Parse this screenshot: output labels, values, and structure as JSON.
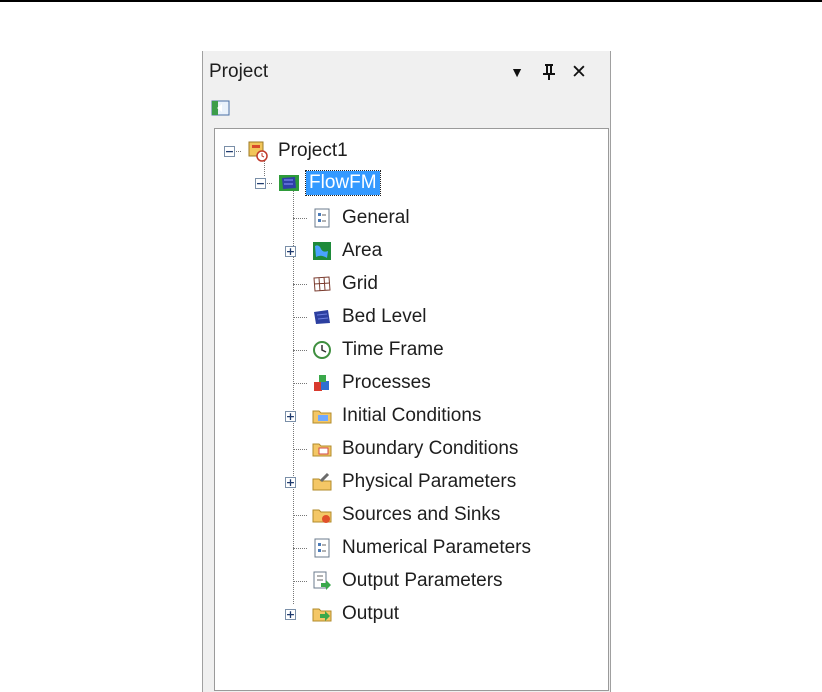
{
  "panel": {
    "title": "Project",
    "controls": {
      "dropdown_glyph": "▼",
      "pin_glyph": "⊥",
      "close_glyph": "✕"
    }
  },
  "tree": {
    "root": {
      "label": "Project1",
      "icon": "project-icon"
    },
    "model": {
      "label": "FlowFM",
      "icon": "flowfm-model-icon",
      "selected": true
    },
    "items": [
      {
        "label": "General",
        "icon": "general-document-icon"
      },
      {
        "label": "Area",
        "icon": "area-map-icon",
        "expandable": true
      },
      {
        "label": "Grid",
        "icon": "grid-icon"
      },
      {
        "label": "Bed Level",
        "icon": "bed-level-icon"
      },
      {
        "label": "Time Frame",
        "icon": "clock-icon"
      },
      {
        "label": "Processes",
        "icon": "processes-icon"
      },
      {
        "label": "Initial Conditions",
        "icon": "initial-conditions-folder-icon",
        "expandable": true
      },
      {
        "label": "Boundary Conditions",
        "icon": "boundary-conditions-folder-icon"
      },
      {
        "label": "Physical Parameters",
        "icon": "physical-parameters-folder-icon",
        "expandable": true
      },
      {
        "label": "Sources and Sinks",
        "icon": "sources-sinks-folder-icon"
      },
      {
        "label": "Numerical Parameters",
        "icon": "numerical-parameters-document-icon"
      },
      {
        "label": "Output Parameters",
        "icon": "output-parameters-document-icon"
      },
      {
        "label": "Output",
        "icon": "output-folder-icon",
        "expandable": true
      }
    ]
  }
}
